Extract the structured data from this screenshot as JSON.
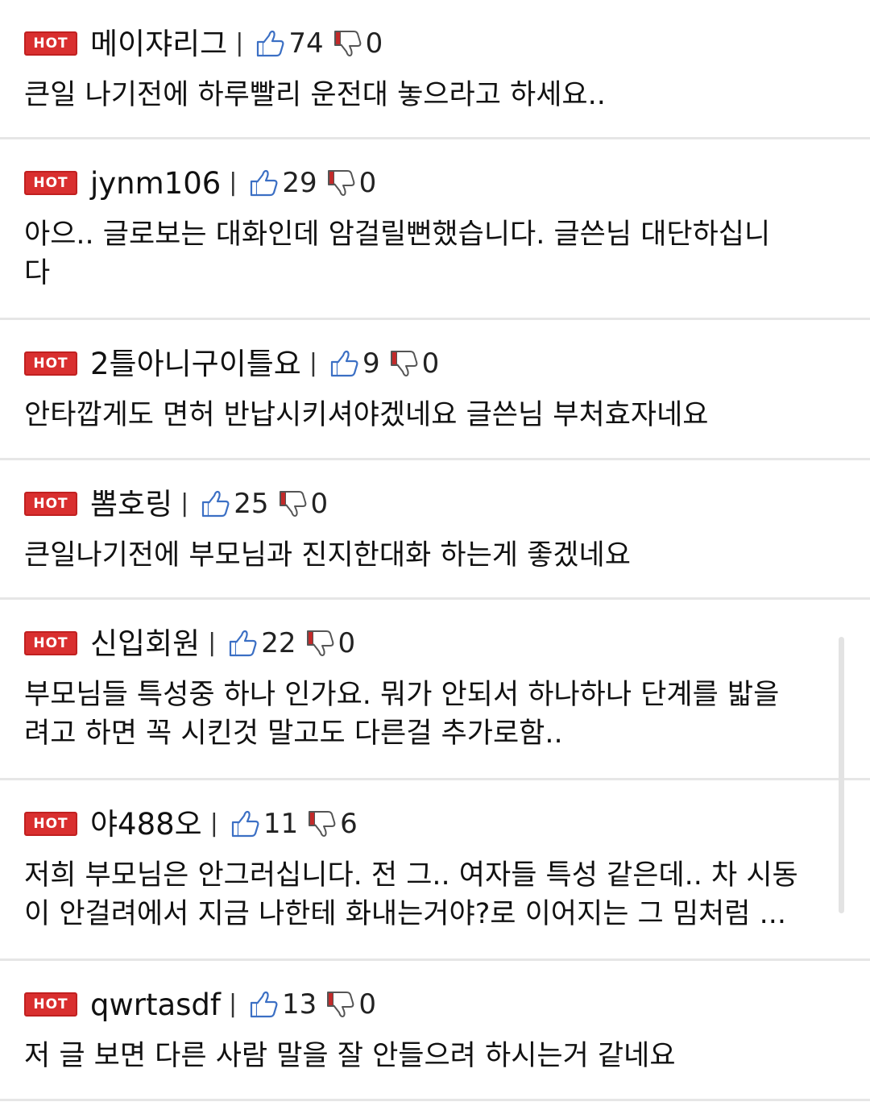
{
  "badge_label": "HOT",
  "separator": "|",
  "colors": {
    "hot_badge": "#d92f2f",
    "thumb_up": "#3b6fc4",
    "thumb_down_fill": "#c22a2a",
    "divider": "#e6e6e6"
  },
  "comments": [
    {
      "username": "메이쟈리그",
      "likes": "74",
      "dislikes": "0",
      "text": "큰일 나기전에 하루빨리 운전대 놓으라고 하세요.."
    },
    {
      "username": "jynm106",
      "likes": "29",
      "dislikes": "0",
      "text_lines": [
        "아으.. 글로보는 대화인데 암걸릴뻔했습니다. 글쓴님 대단하십니",
        "다"
      ]
    },
    {
      "username": "2틀아니구이틀요",
      "likes": "9",
      "dislikes": "0",
      "text": "안타깝게도 면허 반납시키셔야겠네요 글쓴님 부처효자네요"
    },
    {
      "username": "뽐호링",
      "likes": "25",
      "dislikes": "0",
      "text": "큰일나기전에 부모님과 진지한대화 하는게 좋겠네요"
    },
    {
      "username": "신입회원",
      "likes": "22",
      "dislikes": "0",
      "text_lines": [
        "부모님들 특성중 하나 인가요. 뭐가 안되서 하나하나 단계를 밟을",
        "려고 하면 꼭 시킨것 말고도 다른걸 추가로함.."
      ]
    },
    {
      "username": "야488오",
      "likes": "11",
      "dislikes": "6",
      "text_lines": [
        "저희 부모님은 안그러십니다. 전 그.. 여자들 특성 같은데.. 차 시동",
        "이 안걸려에서 지금 나한테 화내는거야?로 이어지는 그 밈처럼 ..."
      ]
    },
    {
      "username": "qwrtasdf",
      "likes": "13",
      "dislikes": "0",
      "text": "저 글 보면 다른 사람 말을 잘 안들으려 하시는거 같네요"
    }
  ]
}
